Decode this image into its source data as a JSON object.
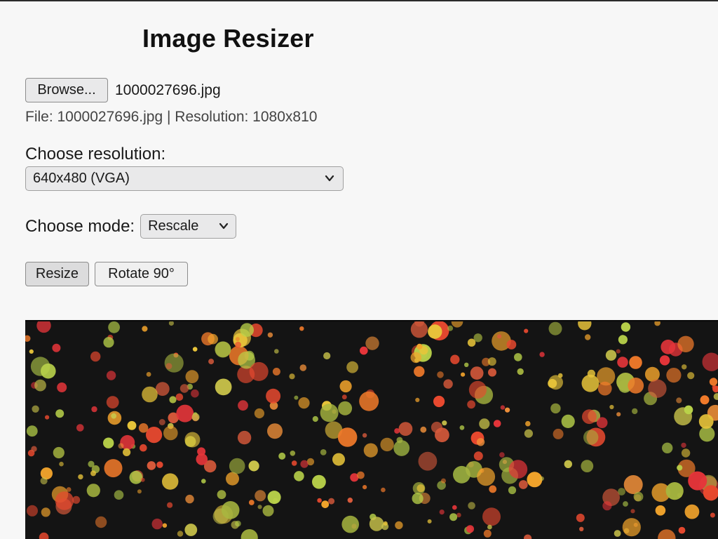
{
  "app": {
    "title": "Image Resizer"
  },
  "file_input": {
    "browse_label": "Browse...",
    "selected_file": "1000027696.jpg"
  },
  "file_info": "File: 1000027696.jpg | Resolution: 1080x810",
  "resolution": {
    "label": "Choose resolution:",
    "selected": "640x480 (VGA)"
  },
  "mode": {
    "label": "Choose mode:",
    "selected": "Rescale"
  },
  "actions": {
    "resize_label": "Resize",
    "rotate_label": "Rotate 90°"
  },
  "preview": {
    "background_color": "#141414",
    "dot_colors": [
      "#e8492f",
      "#f07a2a",
      "#f4a52c",
      "#e8c43a",
      "#c9c34a",
      "#a7b640",
      "#d95a3b",
      "#f2913a",
      "#e5353a",
      "#b9d24a"
    ]
  },
  "icons": {
    "select_arrow": "chevron-down-icon"
  }
}
